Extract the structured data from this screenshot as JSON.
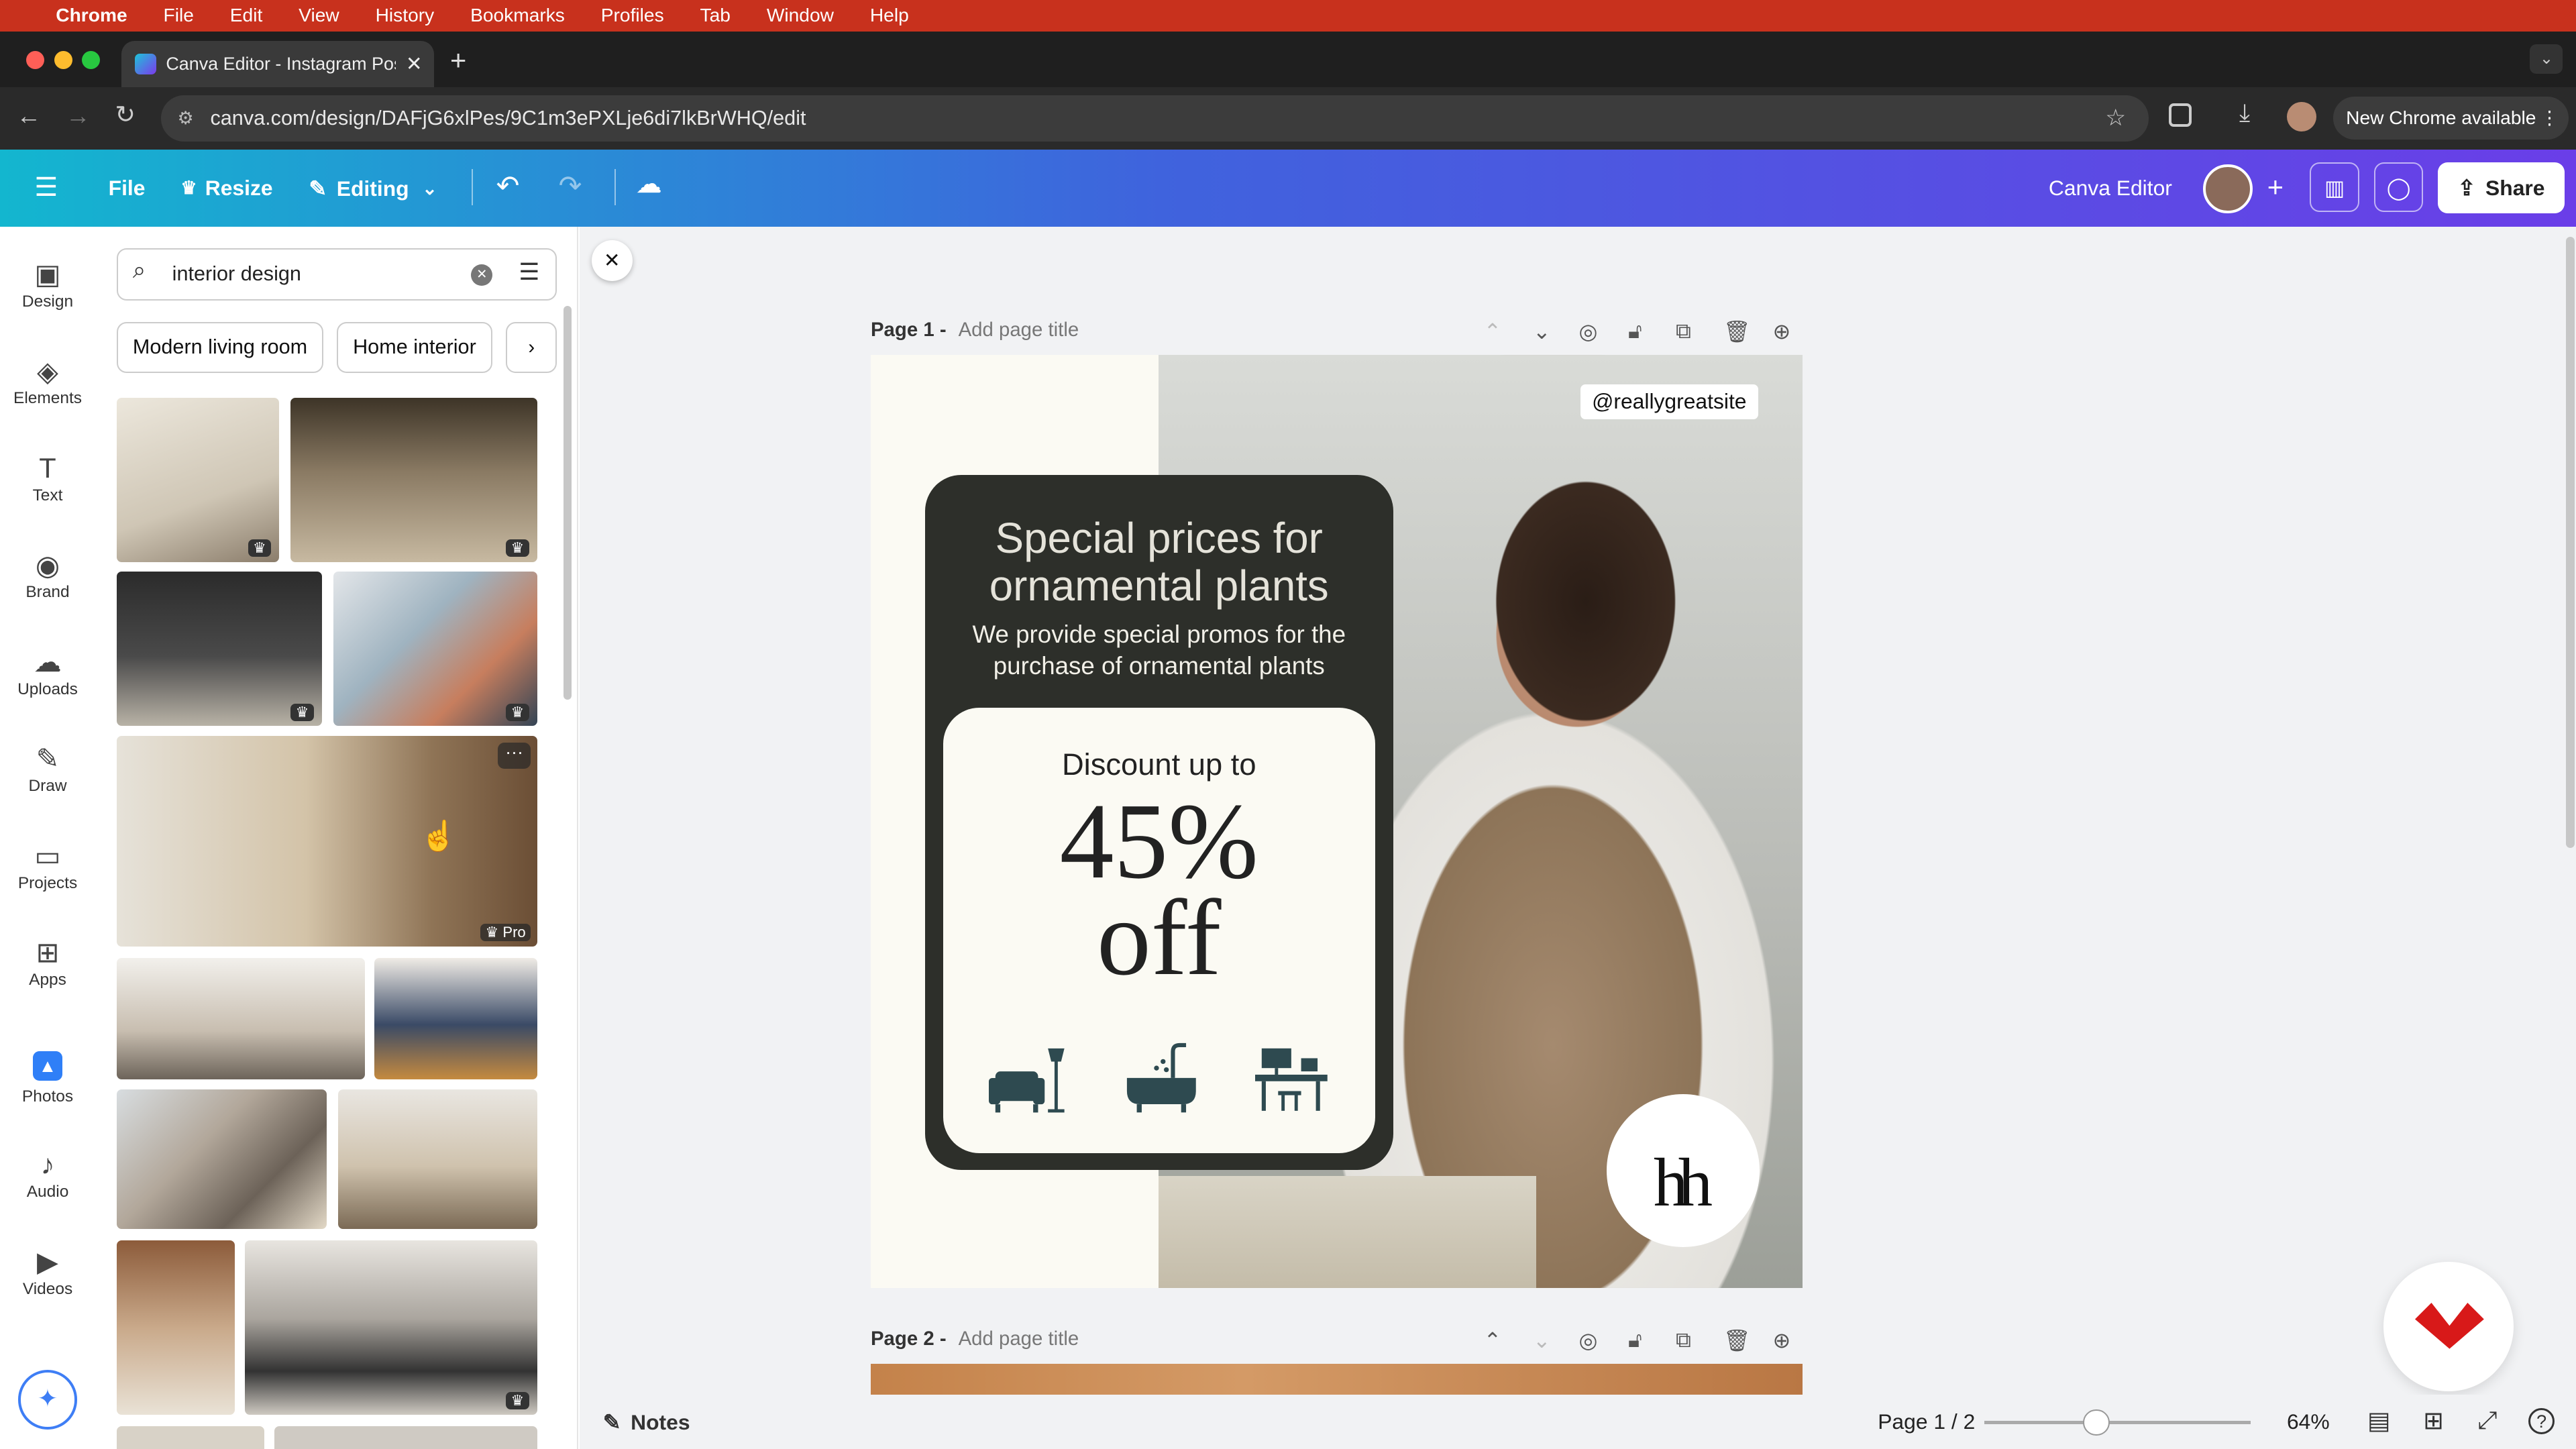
{
  "menubar": {
    "app": "Chrome",
    "items": [
      "File",
      "Edit",
      "View",
      "History",
      "Bookmarks",
      "Profiles",
      "Tab",
      "Window",
      "Help"
    ]
  },
  "browser": {
    "tab_title": "Canva Editor - Instagram Pos",
    "url": "canva.com/design/DAFjG6xlPes/9C1m3ePXLje6di7lkBrWHQ/edit",
    "new_chrome": "New Chrome available"
  },
  "toolbar": {
    "file": "File",
    "resize": "Resize",
    "editing": "Editing",
    "title": "Canva Editor",
    "share": "Share"
  },
  "rail": [
    {
      "label": "Design",
      "icon": "design-icon"
    },
    {
      "label": "Elements",
      "icon": "elements-icon"
    },
    {
      "label": "Text",
      "icon": "text-icon"
    },
    {
      "label": "Brand",
      "icon": "brand-icon"
    },
    {
      "label": "Uploads",
      "icon": "uploads-icon"
    },
    {
      "label": "Draw",
      "icon": "draw-icon"
    },
    {
      "label": "Projects",
      "icon": "projects-icon"
    },
    {
      "label": "Apps",
      "icon": "apps-icon"
    },
    {
      "label": "Photos",
      "icon": "photos-icon"
    },
    {
      "label": "Audio",
      "icon": "audio-icon"
    },
    {
      "label": "Videos",
      "icon": "videos-icon"
    }
  ],
  "search": {
    "value": "interior design",
    "chips": [
      "Modern living room",
      "Home interior"
    ]
  },
  "photo_badge": "Pro",
  "pages": {
    "p1": "Page 1 -",
    "p2": "Page 2 -",
    "add_title": "Add page title"
  },
  "design": {
    "handle": "@reallygreatsite",
    "headline": "Special prices for ornamental plants",
    "sub": "We provide special promos for the purchase of ornamental plants",
    "discount": "Discount up to",
    "pct": "45%",
    "off": "off",
    "logo": "h"
  },
  "footer": {
    "notes": "Notes",
    "page": "Page 1 / 2",
    "zoom": "64%",
    "zoom_level": 0.42
  },
  "colors": {
    "dark": "#2d2f2a",
    "cream": "#fbfaf3",
    "accent": "#8b3dff"
  }
}
